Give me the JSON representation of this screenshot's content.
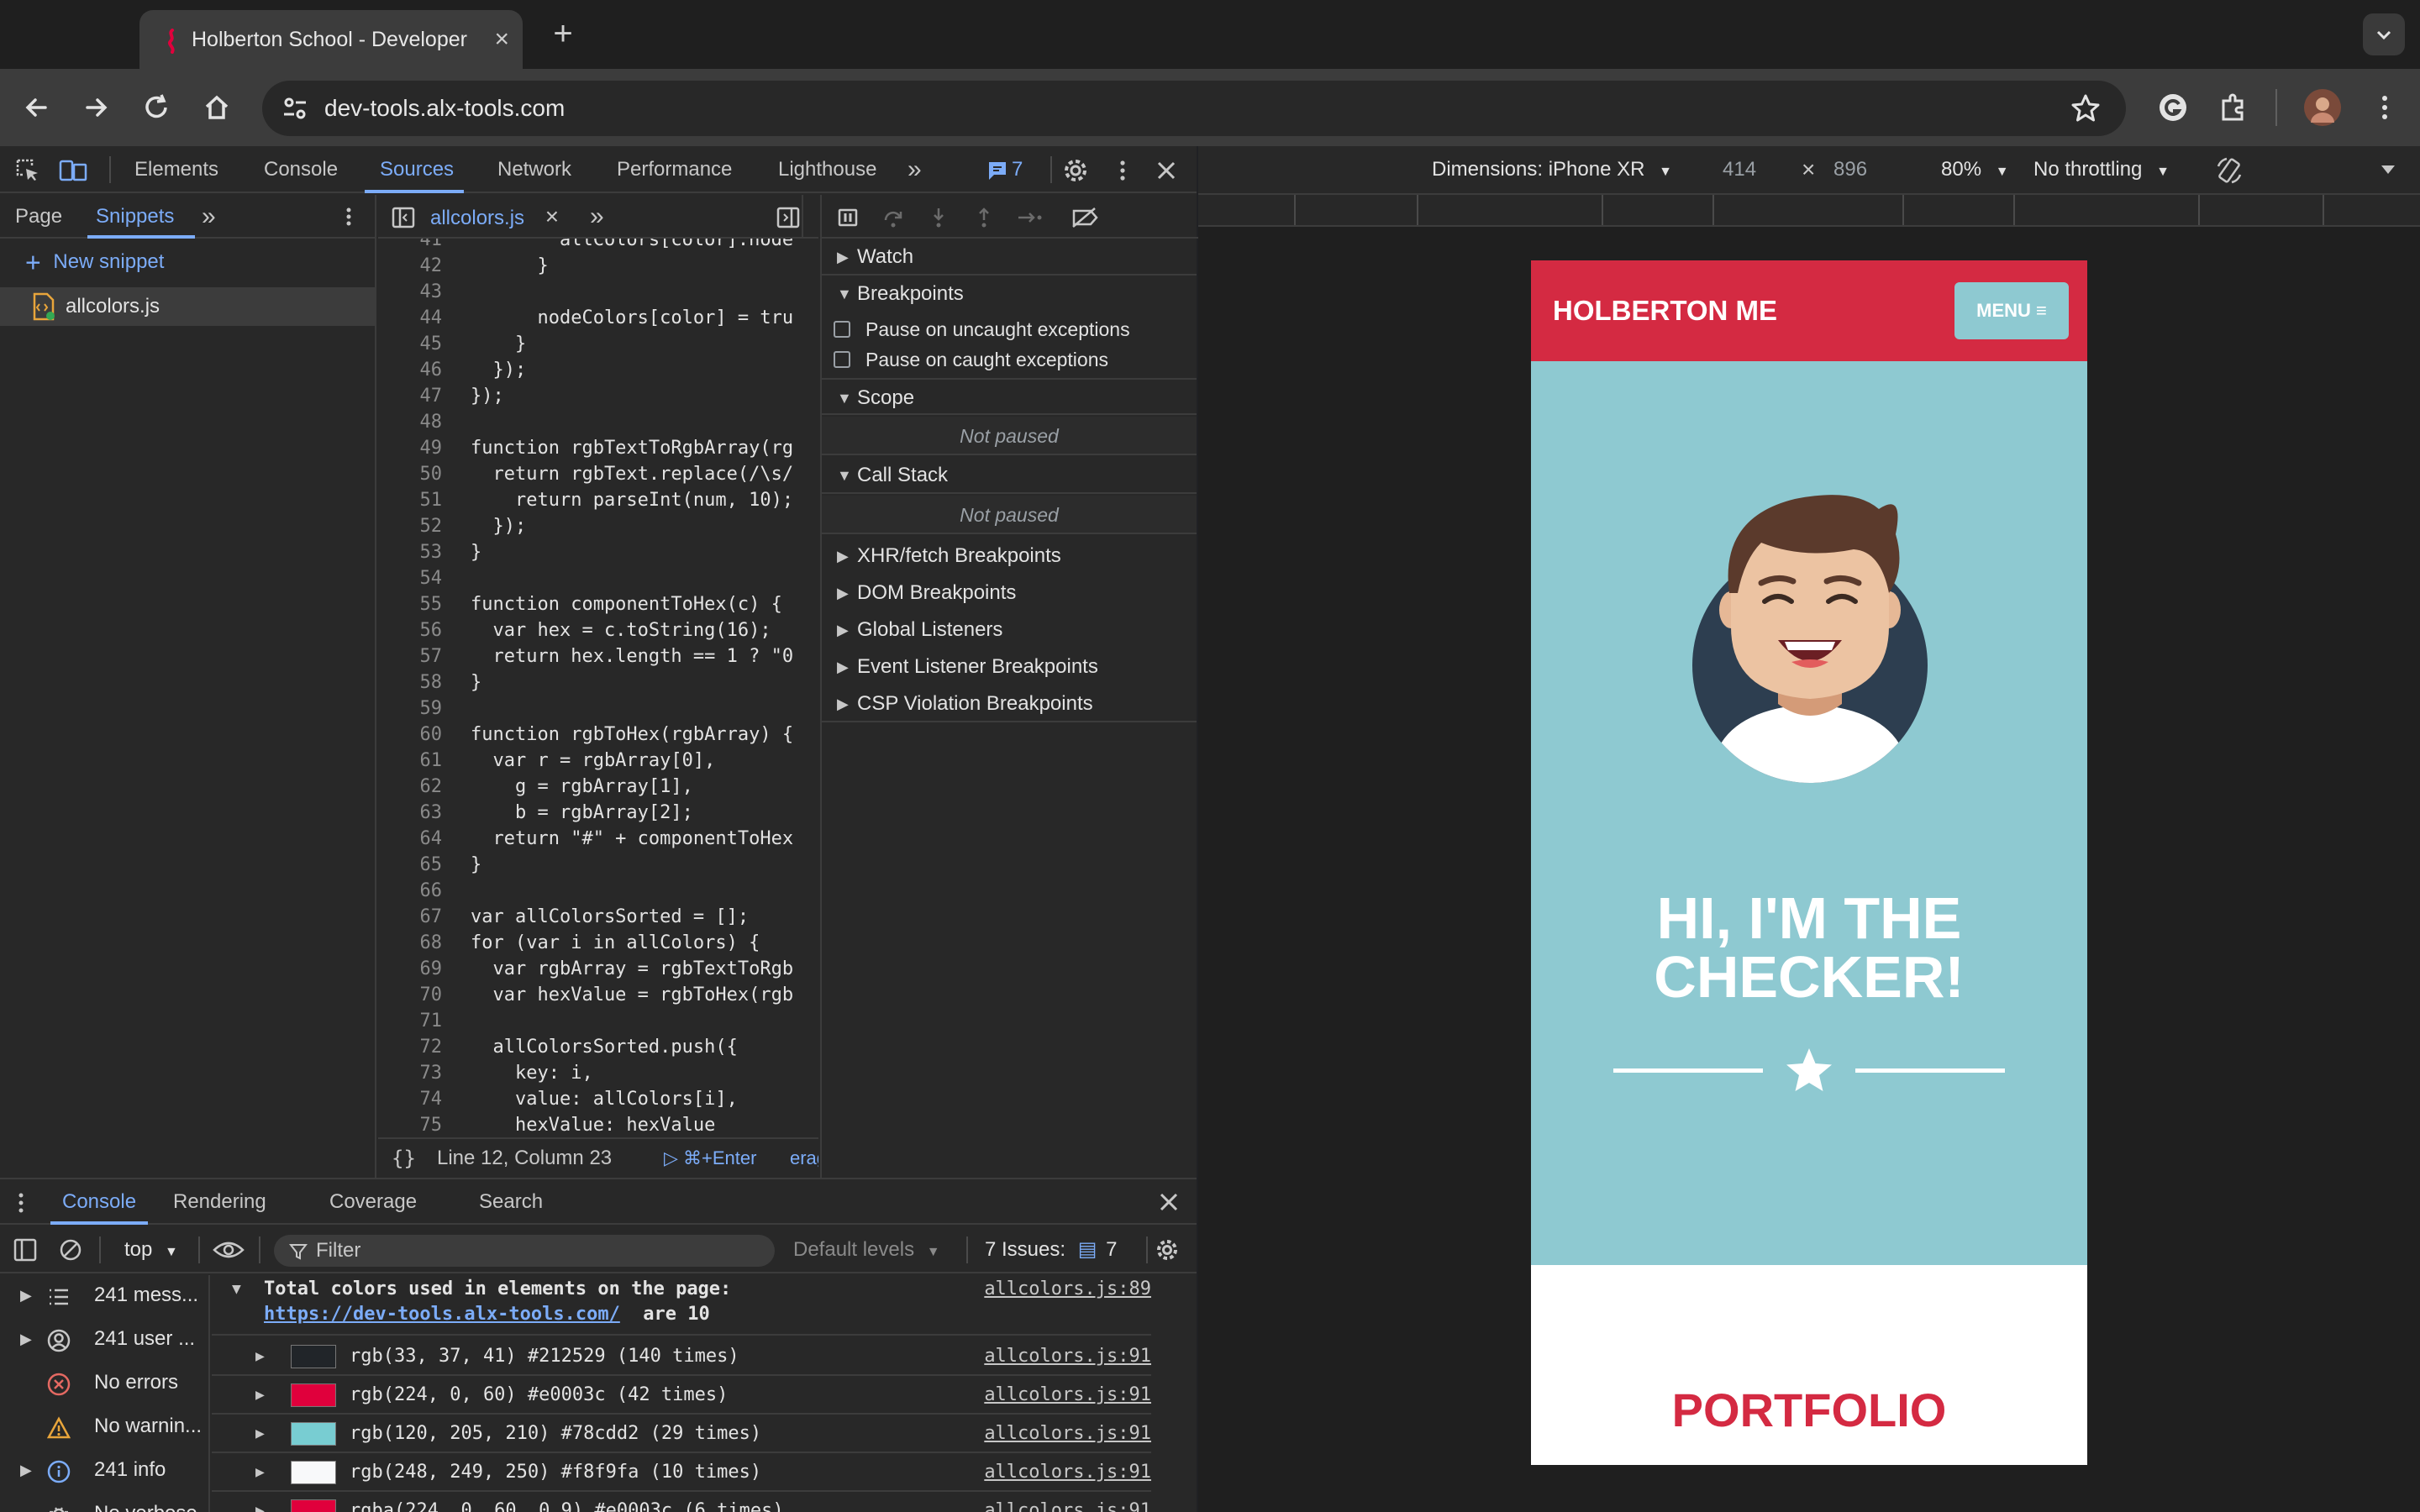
{
  "browser": {
    "tab_title": "Holberton School - Developer Tools",
    "tab_close": "×",
    "new_tab": "+",
    "url": "dev-tools.alx-tools.com"
  },
  "devtools": {
    "tabs": [
      "Elements",
      "Console",
      "Sources",
      "Network",
      "Performance",
      "Lighthouse"
    ],
    "more": "»",
    "issues_count": "7",
    "navigator": {
      "tabs": [
        "Page",
        "Snippets"
      ],
      "new_snippet": "New snippet",
      "snippet_file": "allcolors.js"
    },
    "editor": {
      "file_tab": "allcolors.js",
      "lines": [
        {
          "n": "41",
          "t": "        allColors[color].node"
        },
        {
          "n": "42",
          "t": "      }"
        },
        {
          "n": "43",
          "t": ""
        },
        {
          "n": "44",
          "t": "      nodeColors[color] = tru"
        },
        {
          "n": "45",
          "t": "    }"
        },
        {
          "n": "46",
          "t": "  });"
        },
        {
          "n": "47",
          "t": "});"
        },
        {
          "n": "48",
          "t": ""
        },
        {
          "n": "49",
          "t": "function rgbTextToRgbArray(rg"
        },
        {
          "n": "50",
          "t": "  return rgbText.replace(/\\s/"
        },
        {
          "n": "51",
          "t": "    return parseInt(num, 10);"
        },
        {
          "n": "52",
          "t": "  });"
        },
        {
          "n": "53",
          "t": "}"
        },
        {
          "n": "54",
          "t": ""
        },
        {
          "n": "55",
          "t": "function componentToHex(c) {"
        },
        {
          "n": "56",
          "t": "  var hex = c.toString(16);"
        },
        {
          "n": "57",
          "t": "  return hex.length == 1 ? \"0"
        },
        {
          "n": "58",
          "t": "}"
        },
        {
          "n": "59",
          "t": ""
        },
        {
          "n": "60",
          "t": "function rgbToHex(rgbArray) {"
        },
        {
          "n": "61",
          "t": "  var r = rgbArray[0],"
        },
        {
          "n": "62",
          "t": "    g = rgbArray[1],"
        },
        {
          "n": "63",
          "t": "    b = rgbArray[2];"
        },
        {
          "n": "64",
          "t": "  return \"#\" + componentToHex"
        },
        {
          "n": "65",
          "t": "}"
        },
        {
          "n": "66",
          "t": ""
        },
        {
          "n": "67",
          "t": "var allColorsSorted = [];"
        },
        {
          "n": "68",
          "t": "for (var i in allColors) {"
        },
        {
          "n": "69",
          "t": "  var rgbArray = rgbTextToRgb"
        },
        {
          "n": "70",
          "t": "  var hexValue = rgbToHex(rgb"
        },
        {
          "n": "71",
          "t": ""
        },
        {
          "n": "72",
          "t": "  allColorsSorted.push({"
        },
        {
          "n": "73",
          "t": "    key: i,"
        },
        {
          "n": "74",
          "t": "    value: allColors[i],"
        },
        {
          "n": "75",
          "t": "    hexValue: hexValue"
        }
      ],
      "status_position": "Line 12, Column 23",
      "status_run": "▷ ⌘+Enter",
      "status_extra": "erag"
    },
    "debugger": {
      "watch": "Watch",
      "breakpoints": "Breakpoints",
      "pause_uncaught": "Pause on uncaught exceptions",
      "pause_caught": "Pause on caught exceptions",
      "scope": "Scope",
      "scope_empty": "Not paused",
      "call_stack": "Call Stack",
      "call_stack_empty": "Not paused",
      "xhr": "XHR/fetch Breakpoints",
      "dom": "DOM Breakpoints",
      "global": "Global Listeners",
      "event": "Event Listener Breakpoints",
      "csp": "CSP Violation Breakpoints"
    }
  },
  "drawer": {
    "tabs": [
      "Console",
      "Rendering",
      "Coverage",
      "Search"
    ],
    "context": "top",
    "filter_placeholder": "Filter",
    "levels": "Default levels",
    "issues_label": "7 Issues:",
    "issues_count": "7",
    "sidebar": [
      {
        "label": "241 mess...",
        "expandable": true,
        "icon": "list-icon"
      },
      {
        "label": "241 user ...",
        "expandable": true,
        "icon": "user-icon"
      },
      {
        "label": "No errors",
        "expandable": false,
        "icon": "error-icon"
      },
      {
        "label": "No warnin...",
        "expandable": false,
        "icon": "warning-icon"
      },
      {
        "label": "241 info",
        "expandable": true,
        "icon": "info-icon"
      },
      {
        "label": "No verbose",
        "expandable": false,
        "icon": "bug-icon"
      }
    ],
    "log_header_line1": "Total colors used in elements on the page:",
    "log_header_link": "https://dev-tools.alx-tools.com/",
    "log_header_suffix": " are 10",
    "log_header_src": "allcolors.js:89",
    "log_rows": [
      {
        "color": "#212529",
        "text": "rgb(33, 37, 41) #212529 (140 times)",
        "src": "allcolors.js:91"
      },
      {
        "color": "#e0003c",
        "text": "rgb(224, 0, 60) #e0003c (42 times)",
        "src": "allcolors.js:91"
      },
      {
        "color": "#78cdd2",
        "text": "rgb(120, 205, 210) #78cdd2 (29 times)",
        "src": "allcolors.js:91"
      },
      {
        "color": "#f8f9fa",
        "text": "rgb(248, 249, 250) #f8f9fa (10 times)",
        "src": "allcolors.js:91"
      },
      {
        "color": "#e0003c",
        "text": "rgba(224, 0, 60, 0.9) #e0003c (6 times)",
        "src": "allcolors.js:91"
      }
    ]
  },
  "device": {
    "dimensions": "Dimensions: iPhone XR",
    "width": "414",
    "x": "×",
    "height": "896",
    "zoom": "80%",
    "throttling": "No throttling"
  },
  "site": {
    "logo": "HOLBERTON ME",
    "menu": "MENU ≡",
    "hero_line1": "HI, I'M THE",
    "hero_line2": "CHECKER!",
    "portfolio": "PORTFOLIO",
    "colors": {
      "red": "#d42a42",
      "teal": "#8ec9d1",
      "white": "#ffffff"
    }
  }
}
